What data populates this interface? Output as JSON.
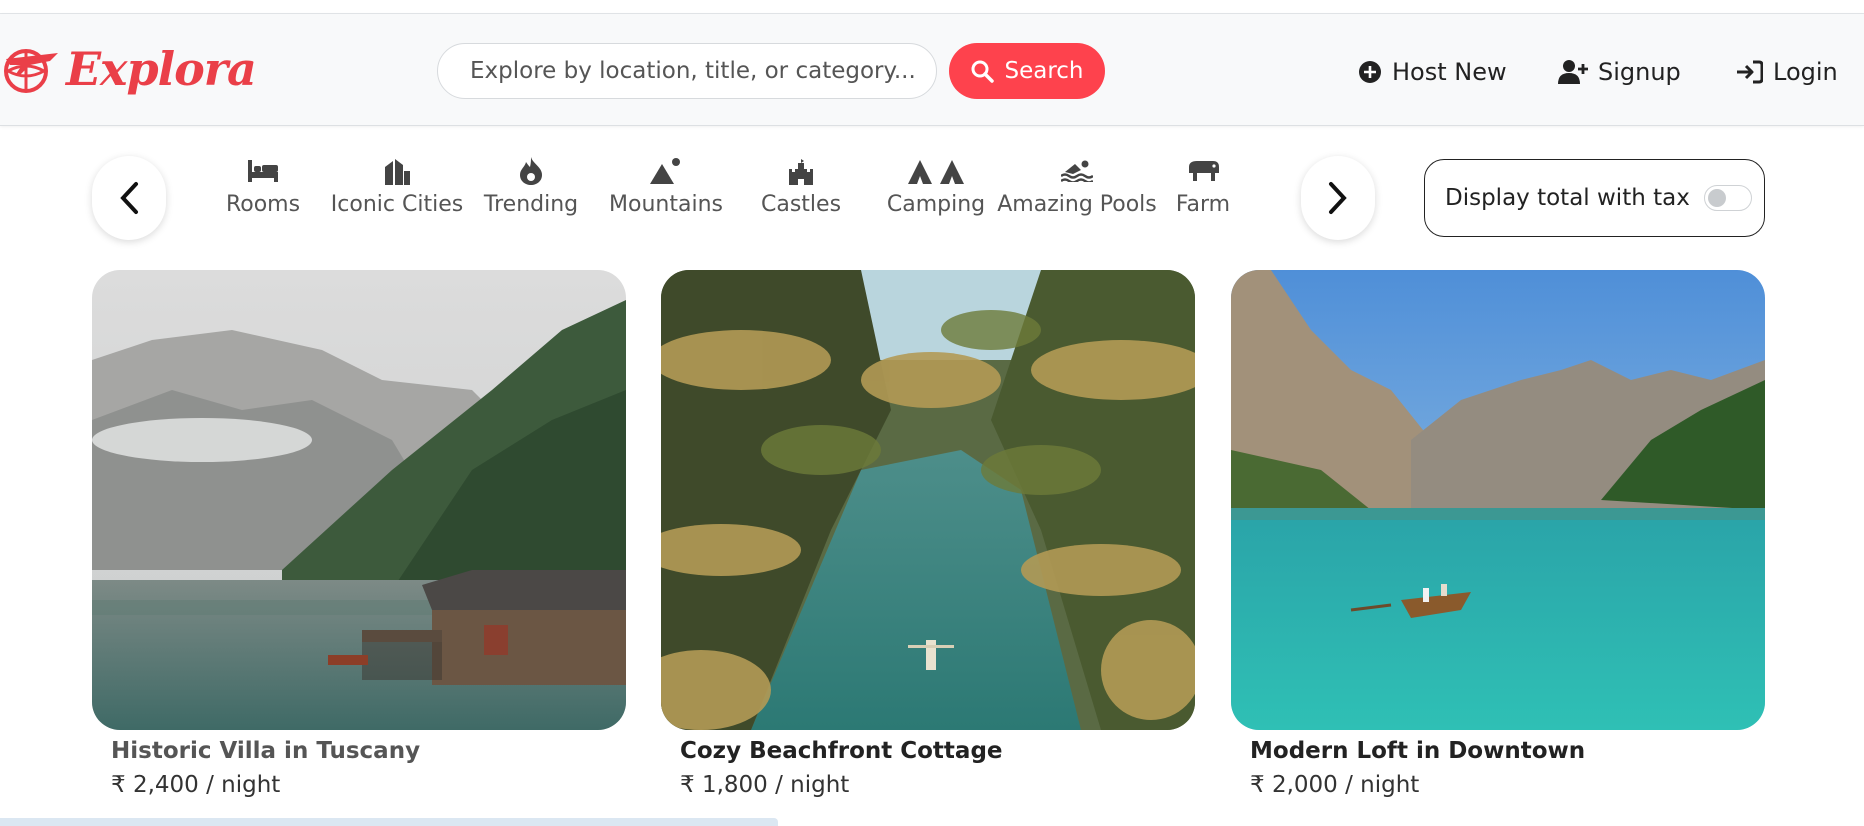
{
  "navbar": {
    "brand": "Explora",
    "search": {
      "placeholder": "Explore by location, title, or category...",
      "value": "",
      "button_label": "Search"
    },
    "links": {
      "host": "Host New",
      "signup": "Signup",
      "login": "Login"
    }
  },
  "filters": {
    "items": [
      {
        "label": "Rooms",
        "icon": "bed-icon"
      },
      {
        "label": "Iconic Cities",
        "icon": "city-icon"
      },
      {
        "label": "Trending",
        "icon": "fire-icon"
      },
      {
        "label": "Mountains",
        "icon": "mountain-icon"
      },
      {
        "label": "Castles",
        "icon": "castle-icon"
      },
      {
        "label": "Camping",
        "icon": "tent-icon"
      },
      {
        "label": "Amazing Pools",
        "icon": "swimmer-icon"
      },
      {
        "label": "Farm",
        "icon": "cow-icon"
      }
    ],
    "tax_toggle": {
      "label": "Display total with tax",
      "checked": false
    }
  },
  "listings": [
    {
      "title": "Historic Villa in Tuscany",
      "price": "₹ 2,400 / night"
    },
    {
      "title": "Cozy Beachfront Cottage",
      "price": "₹ 1,800 / night"
    },
    {
      "title": "Modern Loft in Downtown",
      "price": "₹ 2,000 / night"
    }
  ],
  "colors": {
    "brand": "#fe424d",
    "navbar_bg": "#f8f9fa",
    "text": "#222222"
  }
}
